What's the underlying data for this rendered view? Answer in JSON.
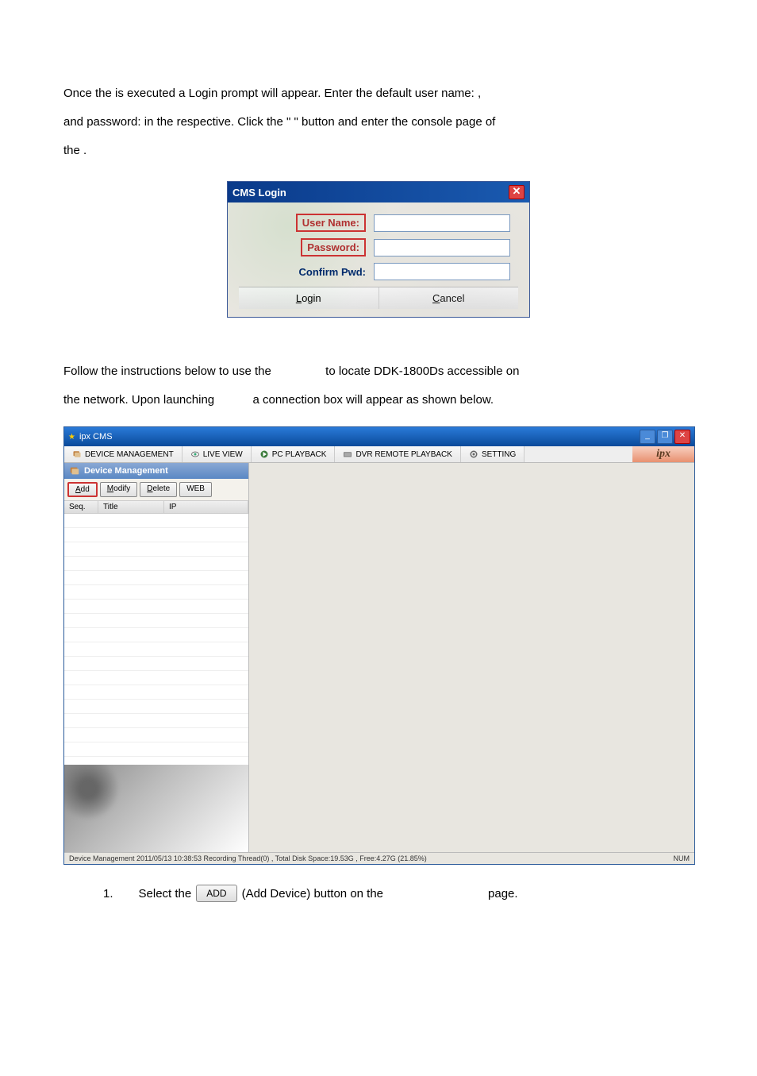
{
  "intro": {
    "line1_a": "Once the ",
    "line1_b": " is executed a Login prompt will appear. Enter the default user name: ",
    "line1_c": " ,",
    "line2_a": "and password: ",
    "line2_b": " in the respective. Click the \" ",
    "line2_c": " \" button and enter the console page of",
    "line3_a": "the ",
    "line3_b": " ."
  },
  "login": {
    "title": "CMS Login",
    "user_label": "User Name:",
    "pwd_label": "Password:",
    "confirm_label": "Confirm Pwd:",
    "login_btn": "Login",
    "cancel_btn": "Cancel"
  },
  "mid": {
    "line1_a": "Follow the instructions below to use the ",
    "line1_b": " to locate DDK-1800Ds accessible on",
    "line2_a": "the network. Upon launching ",
    "line2_b": " a connection box will appear as shown below."
  },
  "cms": {
    "title": "ipx CMS",
    "tabs": {
      "device": "DEVICE MANAGEMENT",
      "live": "LIVE VIEW",
      "pc": "PC PLAYBACK",
      "dvr": "DVR REMOTE PLAYBACK",
      "setting": "SETTING",
      "logo": "ipx"
    },
    "dm": {
      "header": "Device Management",
      "add": "Add",
      "modify": "Modify",
      "delete": "Delete",
      "web": "WEB",
      "col_seq": "Seq.",
      "col_title": "Title",
      "col_ip": "IP"
    },
    "status_left": "Device Management  2011/05/13 10:38:53   Recording Thread(0) , Total Disk Space:19.53G , Free:4.27G (21.85%)",
    "status_right": "NUM"
  },
  "step": {
    "num": "1.",
    "before": "Select the",
    "add_btn": "ADD",
    "mid": "(Add Device) button on the ",
    "after": " page."
  }
}
